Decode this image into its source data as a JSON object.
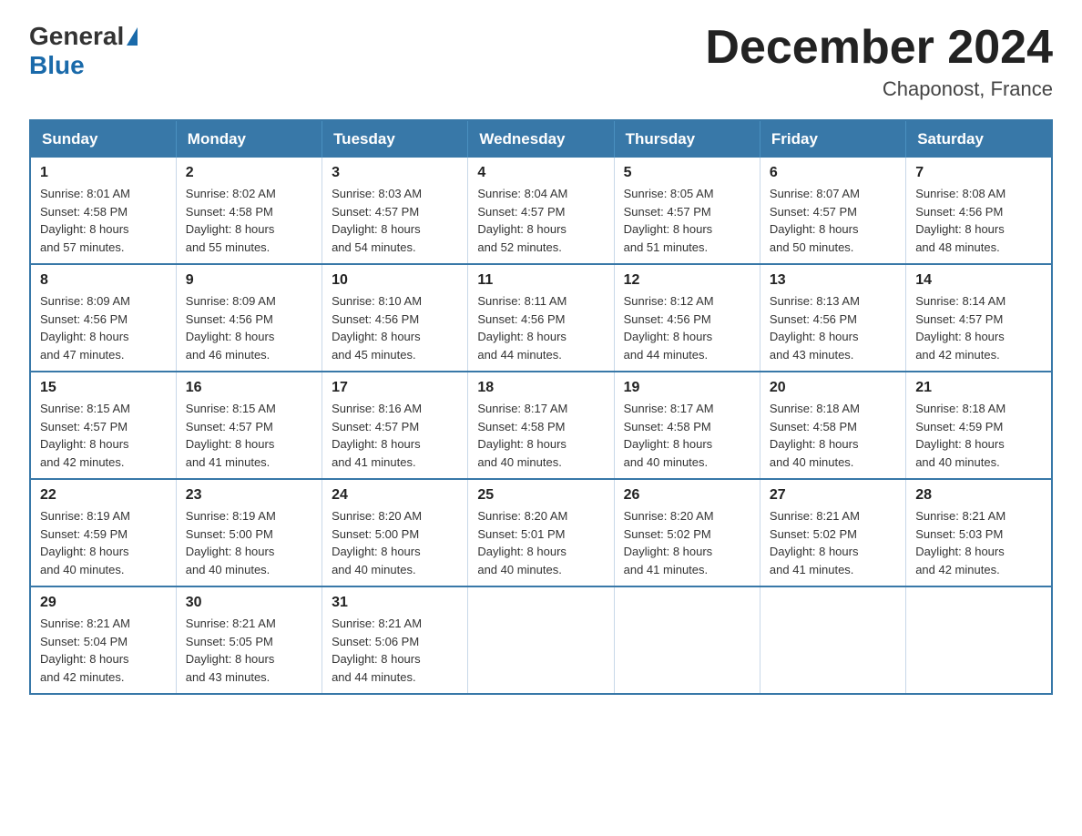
{
  "header": {
    "logo_general": "General",
    "logo_blue": "Blue",
    "month_title": "December 2024",
    "location": "Chaponost, France"
  },
  "days_of_week": [
    "Sunday",
    "Monday",
    "Tuesday",
    "Wednesday",
    "Thursday",
    "Friday",
    "Saturday"
  ],
  "weeks": [
    [
      {
        "day": "1",
        "sunrise": "8:01 AM",
        "sunset": "4:58 PM",
        "daylight": "8 hours and 57 minutes."
      },
      {
        "day": "2",
        "sunrise": "8:02 AM",
        "sunset": "4:58 PM",
        "daylight": "8 hours and 55 minutes."
      },
      {
        "day": "3",
        "sunrise": "8:03 AM",
        "sunset": "4:57 PM",
        "daylight": "8 hours and 54 minutes."
      },
      {
        "day": "4",
        "sunrise": "8:04 AM",
        "sunset": "4:57 PM",
        "daylight": "8 hours and 52 minutes."
      },
      {
        "day": "5",
        "sunrise": "8:05 AM",
        "sunset": "4:57 PM",
        "daylight": "8 hours and 51 minutes."
      },
      {
        "day": "6",
        "sunrise": "8:07 AM",
        "sunset": "4:57 PM",
        "daylight": "8 hours and 50 minutes."
      },
      {
        "day": "7",
        "sunrise": "8:08 AM",
        "sunset": "4:56 PM",
        "daylight": "8 hours and 48 minutes."
      }
    ],
    [
      {
        "day": "8",
        "sunrise": "8:09 AM",
        "sunset": "4:56 PM",
        "daylight": "8 hours and 47 minutes."
      },
      {
        "day": "9",
        "sunrise": "8:09 AM",
        "sunset": "4:56 PM",
        "daylight": "8 hours and 46 minutes."
      },
      {
        "day": "10",
        "sunrise": "8:10 AM",
        "sunset": "4:56 PM",
        "daylight": "8 hours and 45 minutes."
      },
      {
        "day": "11",
        "sunrise": "8:11 AM",
        "sunset": "4:56 PM",
        "daylight": "8 hours and 44 minutes."
      },
      {
        "day": "12",
        "sunrise": "8:12 AM",
        "sunset": "4:56 PM",
        "daylight": "8 hours and 44 minutes."
      },
      {
        "day": "13",
        "sunrise": "8:13 AM",
        "sunset": "4:56 PM",
        "daylight": "8 hours and 43 minutes."
      },
      {
        "day": "14",
        "sunrise": "8:14 AM",
        "sunset": "4:57 PM",
        "daylight": "8 hours and 42 minutes."
      }
    ],
    [
      {
        "day": "15",
        "sunrise": "8:15 AM",
        "sunset": "4:57 PM",
        "daylight": "8 hours and 42 minutes."
      },
      {
        "day": "16",
        "sunrise": "8:15 AM",
        "sunset": "4:57 PM",
        "daylight": "8 hours and 41 minutes."
      },
      {
        "day": "17",
        "sunrise": "8:16 AM",
        "sunset": "4:57 PM",
        "daylight": "8 hours and 41 minutes."
      },
      {
        "day": "18",
        "sunrise": "8:17 AM",
        "sunset": "4:58 PM",
        "daylight": "8 hours and 40 minutes."
      },
      {
        "day": "19",
        "sunrise": "8:17 AM",
        "sunset": "4:58 PM",
        "daylight": "8 hours and 40 minutes."
      },
      {
        "day": "20",
        "sunrise": "8:18 AM",
        "sunset": "4:58 PM",
        "daylight": "8 hours and 40 minutes."
      },
      {
        "day": "21",
        "sunrise": "8:18 AM",
        "sunset": "4:59 PM",
        "daylight": "8 hours and 40 minutes."
      }
    ],
    [
      {
        "day": "22",
        "sunrise": "8:19 AM",
        "sunset": "4:59 PM",
        "daylight": "8 hours and 40 minutes."
      },
      {
        "day": "23",
        "sunrise": "8:19 AM",
        "sunset": "5:00 PM",
        "daylight": "8 hours and 40 minutes."
      },
      {
        "day": "24",
        "sunrise": "8:20 AM",
        "sunset": "5:00 PM",
        "daylight": "8 hours and 40 minutes."
      },
      {
        "day": "25",
        "sunrise": "8:20 AM",
        "sunset": "5:01 PM",
        "daylight": "8 hours and 40 minutes."
      },
      {
        "day": "26",
        "sunrise": "8:20 AM",
        "sunset": "5:02 PM",
        "daylight": "8 hours and 41 minutes."
      },
      {
        "day": "27",
        "sunrise": "8:21 AM",
        "sunset": "5:02 PM",
        "daylight": "8 hours and 41 minutes."
      },
      {
        "day": "28",
        "sunrise": "8:21 AM",
        "sunset": "5:03 PM",
        "daylight": "8 hours and 42 minutes."
      }
    ],
    [
      {
        "day": "29",
        "sunrise": "8:21 AM",
        "sunset": "5:04 PM",
        "daylight": "8 hours and 42 minutes."
      },
      {
        "day": "30",
        "sunrise": "8:21 AM",
        "sunset": "5:05 PM",
        "daylight": "8 hours and 43 minutes."
      },
      {
        "day": "31",
        "sunrise": "8:21 AM",
        "sunset": "5:06 PM",
        "daylight": "8 hours and 44 minutes."
      },
      null,
      null,
      null,
      null
    ]
  ],
  "labels": {
    "sunrise": "Sunrise:",
    "sunset": "Sunset:",
    "daylight": "Daylight:"
  }
}
